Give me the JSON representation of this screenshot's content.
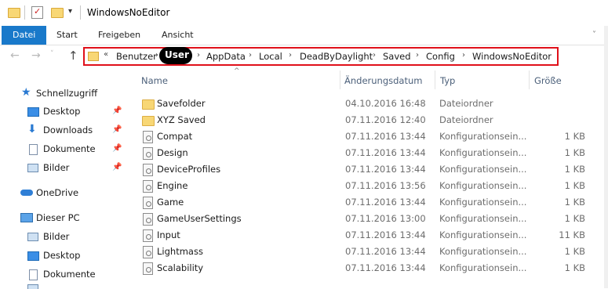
{
  "window": {
    "title": "WindowsNoEditor"
  },
  "ribbon": {
    "tabs": [
      "Datei",
      "Start",
      "Freigeben",
      "Ansicht"
    ]
  },
  "address": {
    "overflow": "«",
    "crumbs": [
      "Benutzer",
      "User",
      "AppData",
      "Local",
      "DeadByDaylight",
      "Saved",
      "Config",
      "WindowsNoEditor"
    ],
    "separator": "›",
    "highlight_color": "#e0101a"
  },
  "columns": {
    "name": "Name",
    "date": "Änderungsdatum",
    "type": "Typ",
    "size": "Größe"
  },
  "sidebar": {
    "quick_access": "Schnellzugriff",
    "quick_items": [
      "Desktop",
      "Downloads",
      "Dokumente",
      "Bilder"
    ],
    "onedrive": "OneDrive",
    "this_pc": "Dieser PC",
    "pc_items": [
      "Bilder",
      "Desktop",
      "Dokumente"
    ]
  },
  "files": [
    {
      "icon": "folder-icon",
      "name": "Savefolder",
      "date": "04.10.2016 16:48",
      "type": "Dateiordner",
      "size": ""
    },
    {
      "icon": "folder-icon",
      "name": "XYZ Saved",
      "date": "07.11.2016 12:40",
      "type": "Dateiordner",
      "size": ""
    },
    {
      "icon": "config-file-icon",
      "name": "Compat",
      "date": "07.11.2016 13:44",
      "type": "Konfigurationsein...",
      "size": "1 KB"
    },
    {
      "icon": "config-file-icon",
      "name": "Design",
      "date": "07.11.2016 13:44",
      "type": "Konfigurationsein...",
      "size": "1 KB"
    },
    {
      "icon": "config-file-icon",
      "name": "DeviceProfiles",
      "date": "07.11.2016 13:44",
      "type": "Konfigurationsein...",
      "size": "1 KB"
    },
    {
      "icon": "config-file-icon",
      "name": "Engine",
      "date": "07.11.2016 13:56",
      "type": "Konfigurationsein...",
      "size": "1 KB"
    },
    {
      "icon": "config-file-icon",
      "name": "Game",
      "date": "07.11.2016 13:44",
      "type": "Konfigurationsein...",
      "size": "1 KB"
    },
    {
      "icon": "config-file-icon",
      "name": "GameUserSettings",
      "date": "07.11.2016 13:00",
      "type": "Konfigurationsein...",
      "size": "1 KB"
    },
    {
      "icon": "config-file-icon",
      "name": "Input",
      "date": "07.11.2016 13:44",
      "type": "Konfigurationsein...",
      "size": "11 KB"
    },
    {
      "icon": "config-file-icon",
      "name": "Lightmass",
      "date": "07.11.2016 13:44",
      "type": "Konfigurationsein...",
      "size": "1 KB"
    },
    {
      "icon": "config-file-icon",
      "name": "Scalability",
      "date": "07.11.2016 13:44",
      "type": "Konfigurationsein...",
      "size": "1 KB"
    }
  ]
}
